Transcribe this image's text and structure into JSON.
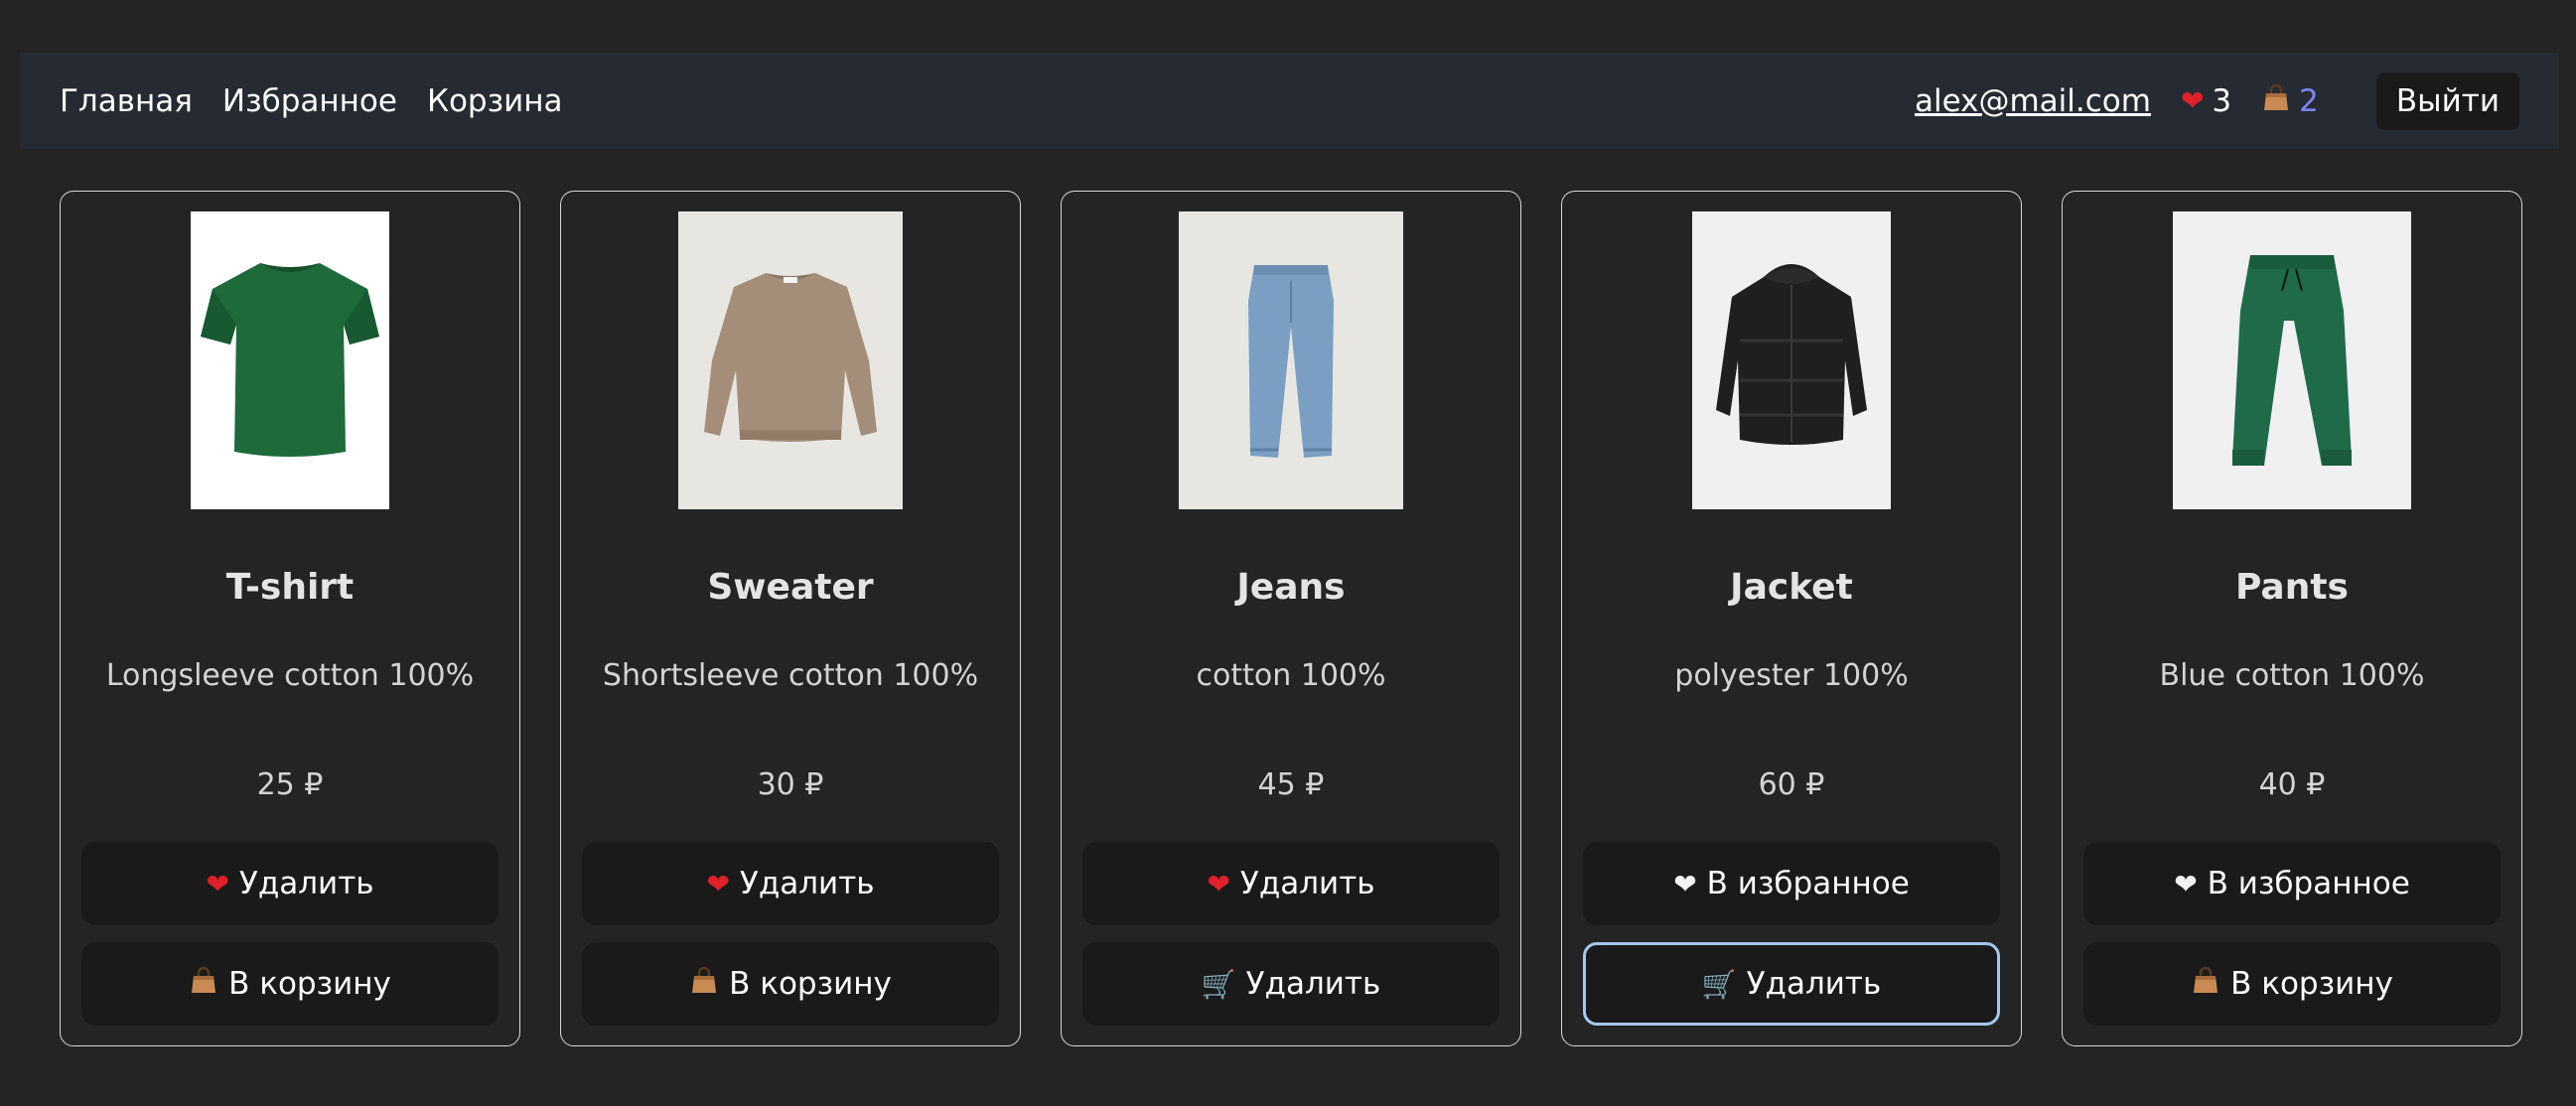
{
  "nav": {
    "links": [
      "Главная",
      "Избранное",
      "Корзина"
    ],
    "email": "alex@mail.com",
    "fav_count": "3",
    "cart_count": "2",
    "logout": "Выйти"
  },
  "products": [
    {
      "title": "T-shirt",
      "desc": "Longsleeve cotton 100%",
      "price": "25 ₽",
      "fav_label": "Удалить",
      "fav_icon": "red-heart-icon",
      "cart_label": "В корзину",
      "cart_icon": "shopping-bag-icon",
      "image": "green-tshirt"
    },
    {
      "title": "Sweater",
      "desc": "Shortsleeve cotton 100%",
      "price": "30 ₽",
      "fav_label": "Удалить",
      "fav_icon": "red-heart-icon",
      "cart_label": "В корзину",
      "cart_icon": "shopping-bag-icon",
      "image": "beige-sweater"
    },
    {
      "title": "Jeans",
      "desc": "cotton 100%",
      "price": "45 ₽",
      "fav_label": "Удалить",
      "fav_icon": "red-heart-icon",
      "cart_label": "Удалить",
      "cart_icon": "shopping-cart-icon",
      "image": "blue-jeans"
    },
    {
      "title": "Jacket",
      "desc": "polyester 100%",
      "price": "60 ₽",
      "fav_label": "В избранное",
      "fav_icon": "white-heart-icon",
      "cart_label": "Удалить",
      "cart_icon": "shopping-cart-icon",
      "image": "black-puffer-jacket"
    },
    {
      "title": "Pants",
      "desc": "Blue cotton 100%",
      "price": "40 ₽",
      "fav_label": "В избранное",
      "fav_icon": "white-heart-icon",
      "cart_label": "В корзину",
      "cart_icon": "shopping-bag-icon",
      "image": "green-sweatpants"
    }
  ],
  "colors": {
    "background": "#242424",
    "navbar": "#262a33",
    "button": "#1a1a1a",
    "focus_ring": "#a4c8f0",
    "cart_count": "#7b86ee"
  }
}
